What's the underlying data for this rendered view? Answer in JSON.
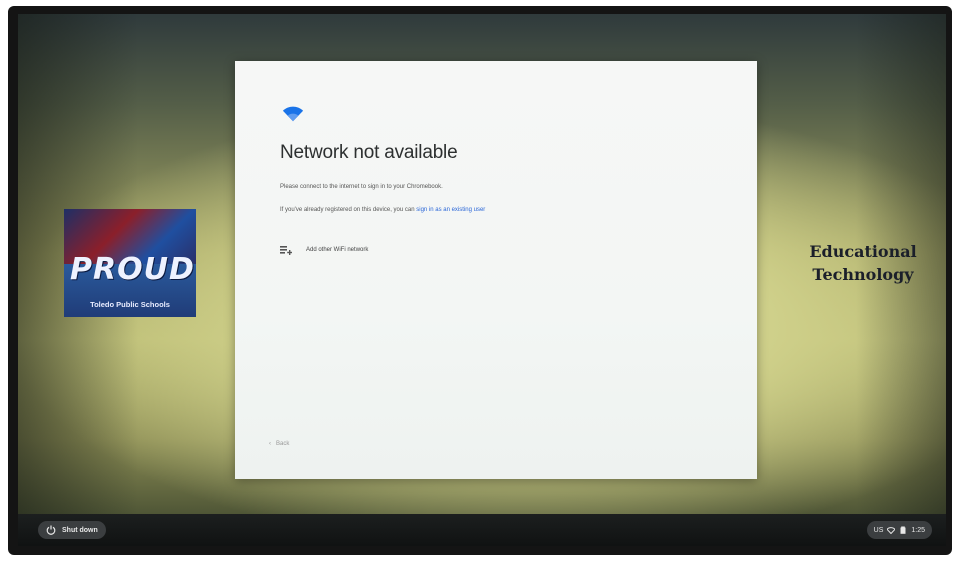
{
  "logo": {
    "word": "PROUD",
    "subtitle": "Toledo Public Schools"
  },
  "wallpaper_text": {
    "line1": "Educational",
    "line2": "Technology"
  },
  "dialog": {
    "icon": "wifi-icon",
    "title": "Network not available",
    "message": "Please connect to the internet to sign in to your Chromebook.",
    "signed_in_prefix": "If you've already registered on this device, you can ",
    "signed_in_link": "sign in as an existing user",
    "add_wifi_label": "Add other WiFi network",
    "back_label": "Back"
  },
  "shelf": {
    "shutdown_label": "Shut down",
    "locale": "US",
    "time": "1:25"
  },
  "colors": {
    "link": "#2a66d8",
    "wifi": "#1a73e8"
  }
}
